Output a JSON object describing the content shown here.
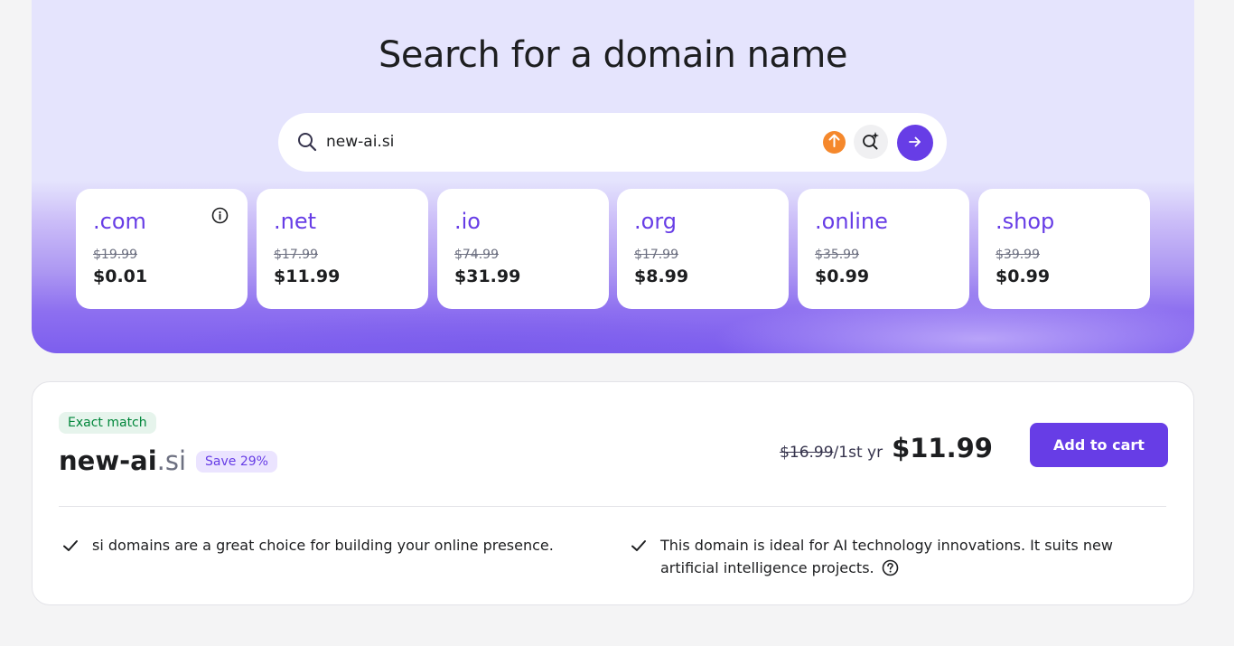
{
  "hero": {
    "title": "Search for a domain name"
  },
  "search": {
    "value": "new-ai.si",
    "placeholder": ""
  },
  "tlds": [
    {
      "name": ".com",
      "old_price": "$19.99",
      "price": "$0.01"
    },
    {
      "name": ".net",
      "old_price": "$17.99",
      "price": "$11.99"
    },
    {
      "name": ".io",
      "old_price": "$74.99",
      "price": "$31.99"
    },
    {
      "name": ".org",
      "old_price": "$17.99",
      "price": "$8.99"
    },
    {
      "name": ".online",
      "old_price": "$35.99",
      "price": "$0.99"
    },
    {
      "name": ".shop",
      "old_price": "$39.99",
      "price": "$0.99"
    }
  ],
  "result": {
    "badge": "Exact match",
    "domain_base": "new-ai",
    "domain_tld": ".si",
    "save_badge": "Save 29%",
    "old_price": "$16.99",
    "period": "/1st yr",
    "price": "$11.99",
    "cart_label": "Add to cart",
    "features": [
      "si domains are a great choice for building your online presence.",
      "This domain is ideal for AI technology innovations. It suits new artificial intelligence projects."
    ]
  },
  "colors": {
    "brand": "#673de6",
    "accent_orange": "#f5882c",
    "success": "#00863a"
  },
  "icons": {
    "search": "search-icon",
    "upload": "upload-icon",
    "ai_search": "ai-search-icon",
    "go": "arrow-right-icon",
    "info": "info-icon",
    "check": "check-icon",
    "help": "help-icon"
  }
}
